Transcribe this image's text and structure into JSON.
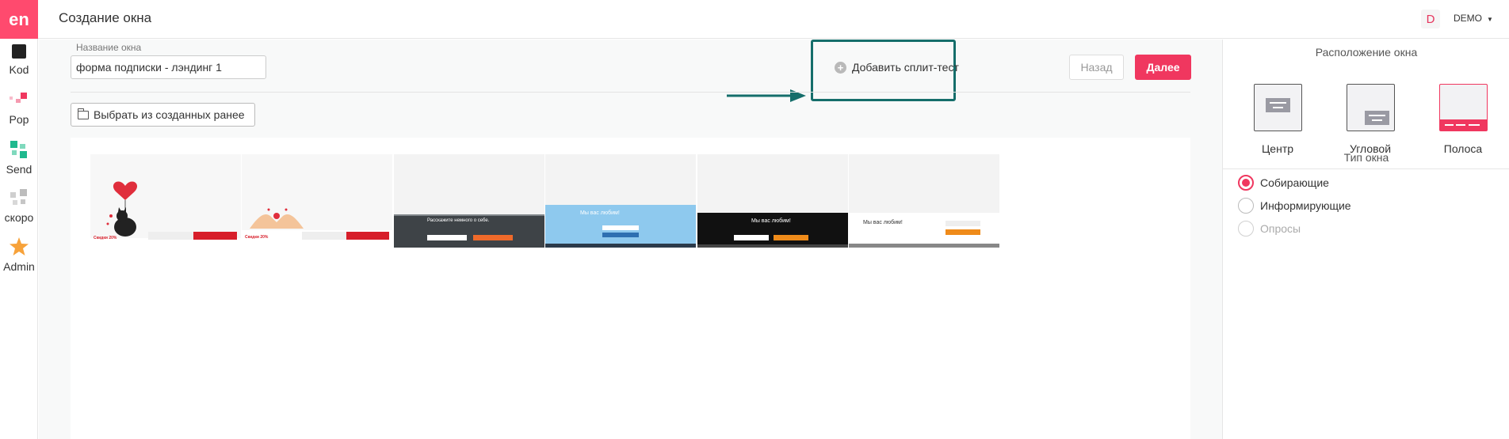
{
  "app": {
    "logo_text": "en",
    "brand_color": "#ff4a6e",
    "accent_color": "#f0375f"
  },
  "rail": {
    "items": [
      {
        "label": "Kod",
        "icon": "square-icon"
      },
      {
        "label": "Pop",
        "icon": "dots-icon"
      },
      {
        "label": "Send",
        "icon": "grid-icon"
      },
      {
        "label": "скоро",
        "icon": "grid-gray-icon"
      },
      {
        "label": "Admin",
        "icon": "star-icon"
      }
    ]
  },
  "header": {
    "title": "Создание окна",
    "avatar_letter": "D",
    "account_label": "DEMO"
  },
  "form": {
    "name_label": "Название окна",
    "name_value": "форма подписки - лэндинг 1",
    "split_test_label": "Добавить сплит-тест",
    "back_label": "Назад",
    "next_label": "Далее",
    "choose_label": "Выбрать из созданных ранее"
  },
  "templates": [
    {
      "title": "Скидки 20%",
      "style": "cat-heart"
    },
    {
      "title": "Скидки 20%",
      "style": "hands-heart"
    },
    {
      "title": "Расскажите немного о себе.",
      "style": "dark-form"
    },
    {
      "title": "Мы вас любим!",
      "style": "blue-form"
    },
    {
      "title": "Мы вас любим!",
      "style": "black-form"
    },
    {
      "title": "Мы вас любим!",
      "style": "white-form"
    }
  ],
  "right_panel": {
    "position_title": "Расположение окна",
    "positions": [
      {
        "label": "Центр",
        "selected": false
      },
      {
        "label": "Угловой",
        "selected": false
      },
      {
        "label": "Полоса",
        "selected": true
      }
    ],
    "type_title": "Тип окна",
    "types": [
      {
        "label": "Собирающие",
        "checked": true,
        "disabled": false
      },
      {
        "label": "Информирующие",
        "checked": false,
        "disabled": false
      },
      {
        "label": "Опросы",
        "checked": false,
        "disabled": true
      }
    ]
  }
}
